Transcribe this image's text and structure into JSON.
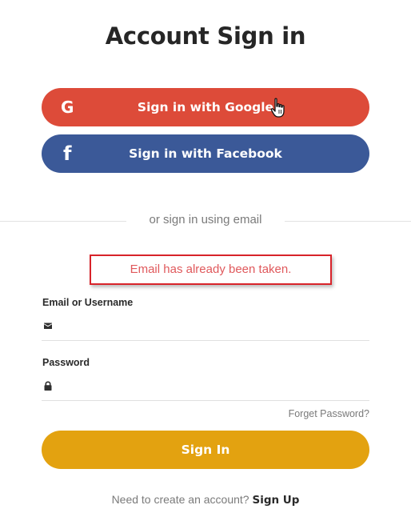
{
  "title": "Account Sign in",
  "social": {
    "google": {
      "label": "Sign in with Google",
      "icon": "google-g-icon",
      "icon_glyph": "G",
      "color": "#dd4b39"
    },
    "facebook": {
      "label": "Sign in with Facebook",
      "icon": "facebook-f-icon",
      "icon_glyph": "f",
      "color": "#3b5998"
    }
  },
  "divider_text": "or sign in using email",
  "error": {
    "message": "Email has already been taken.",
    "border_color": "#d8232a",
    "text_color": "#e0595c"
  },
  "form": {
    "email": {
      "label": "Email or Username",
      "value": "",
      "icon": "envelope-icon"
    },
    "password": {
      "label": "Password",
      "value": "",
      "icon": "lock-icon"
    },
    "forgot_label": "Forget Password?",
    "submit_label": "Sign In",
    "submit_color": "#e3a210"
  },
  "footer": {
    "prompt": "Need to create an account?",
    "link_label": "Sign Up"
  }
}
